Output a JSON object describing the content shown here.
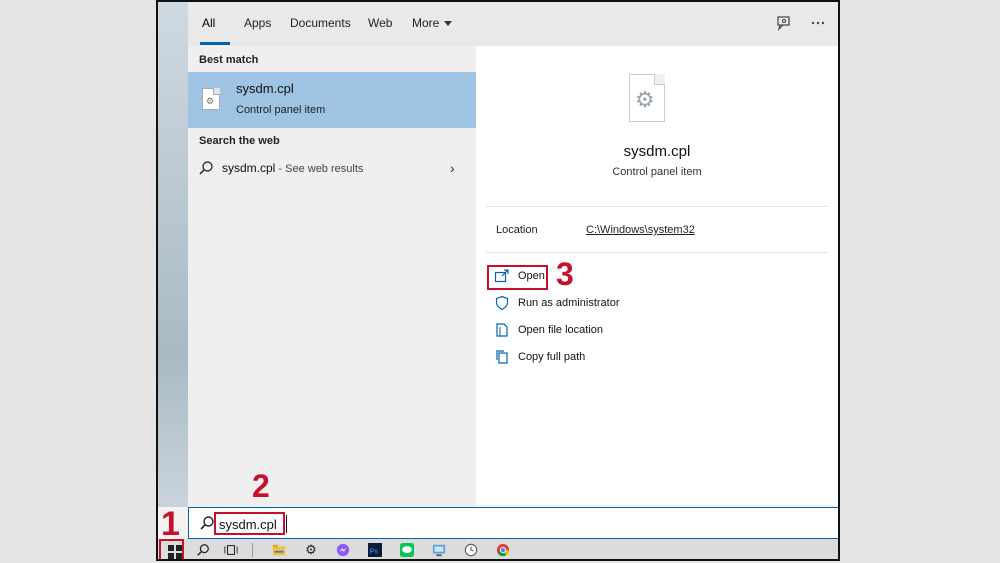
{
  "tabs": [
    {
      "label": "All"
    },
    {
      "label": "Apps"
    },
    {
      "label": "Documents"
    },
    {
      "label": "Web"
    },
    {
      "label": "More"
    }
  ],
  "left_panel": {
    "best_match_heading": "Best match",
    "best_match": {
      "title": "sysdm.cpl",
      "subtitle": "Control panel item"
    },
    "search_web_heading": "Search the web",
    "web_result": {
      "query": "sysdm.cpl",
      "suffix": " - See web results"
    }
  },
  "right_panel": {
    "title": "sysdm.cpl",
    "subtitle": "Control panel item",
    "location_label": "Location",
    "location_value": "C:\\Windows\\system32",
    "actions": [
      {
        "label": "Open",
        "icon": "open-icon"
      },
      {
        "label": "Run as administrator",
        "icon": "shield-icon"
      },
      {
        "label": "Open file location",
        "icon": "folder-icon"
      },
      {
        "label": "Copy full path",
        "icon": "copy-icon"
      }
    ]
  },
  "search": {
    "value": "sysdm.cpl"
  },
  "annotations": {
    "step1": "1",
    "step2": "2",
    "step3": "3"
  },
  "colors": {
    "accent": "#0063b1",
    "selection": "#9fc4e3",
    "annotation_red": "#c8102e"
  },
  "taskbar_icons": [
    "windows-start-icon",
    "search-icon",
    "task-view-icon",
    "file-explorer-icon",
    "settings-icon",
    "messenger-icon",
    "photoshop-icon",
    "line-icon",
    "remote-desktop-icon",
    "clock-icon",
    "chrome-icon"
  ]
}
